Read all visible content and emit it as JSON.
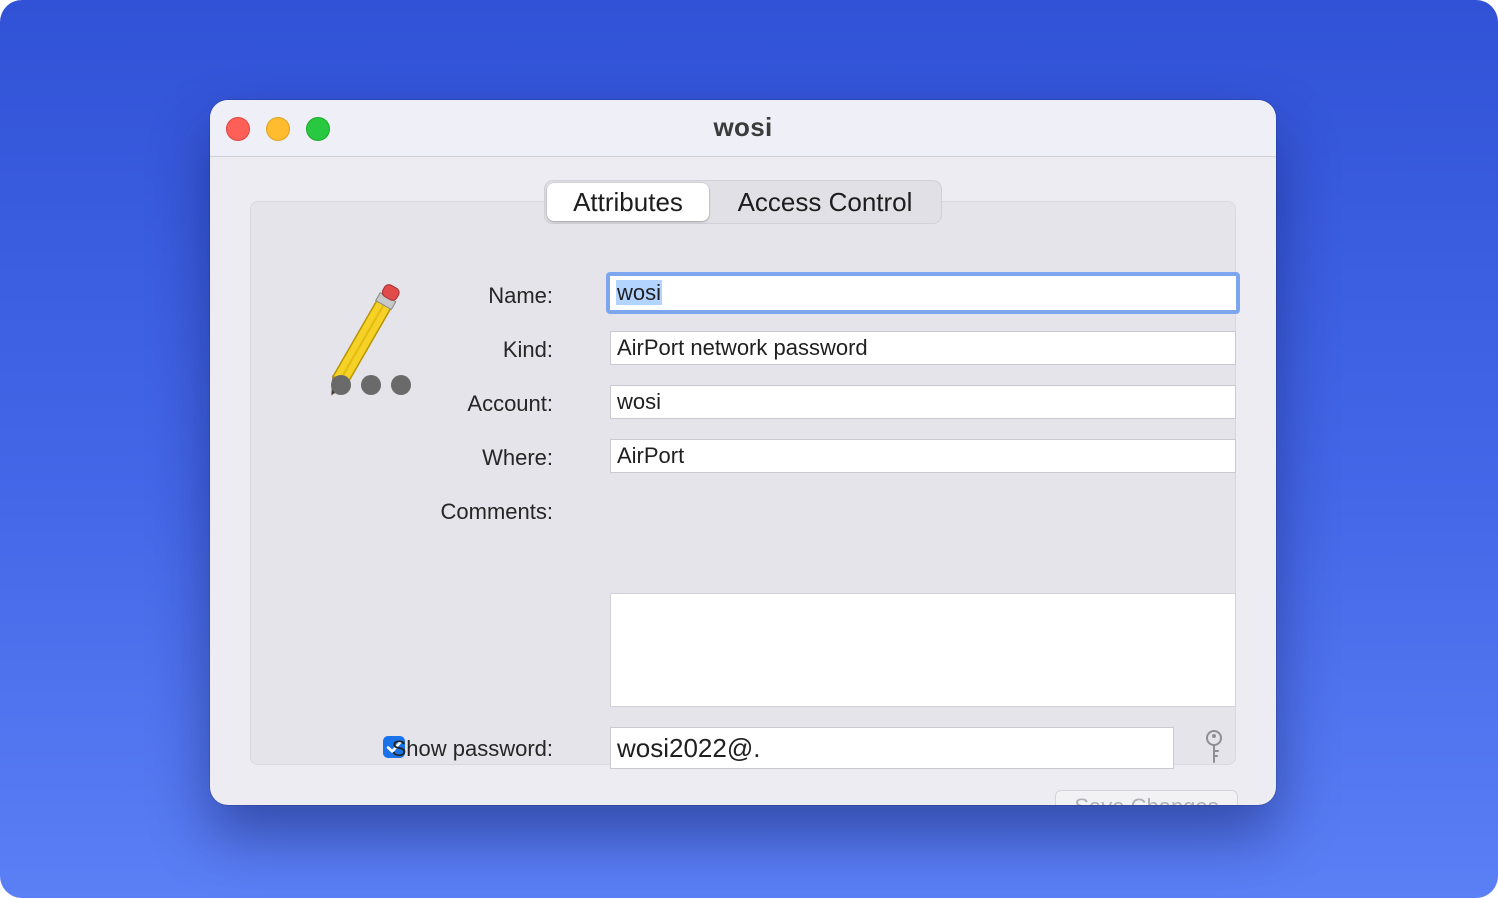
{
  "window": {
    "title": "wosi",
    "controls": [
      "close",
      "minimize",
      "zoom"
    ]
  },
  "tabs": [
    {
      "label": "Attributes",
      "active": true
    },
    {
      "label": "Access Control",
      "active": false
    }
  ],
  "form": {
    "name_label": "Name:",
    "name_value": "wosi",
    "kind_label": "Kind:",
    "kind_value": "AirPort network password",
    "account_label": "Account:",
    "account_value": "wosi",
    "where_label": "Where:",
    "where_value": "AirPort",
    "comments_label": "Comments:",
    "comments_value": "",
    "show_password_label": "Show password:",
    "show_password_checked": true,
    "password_value": "wosi2022@.",
    "save_label": "Save Changes"
  },
  "icons": {
    "item_icon": "pencil-password-icon",
    "key": "key-icon",
    "checkmark": "checkmark-icon"
  },
  "colors": {
    "accent": "#1a73e8",
    "focus_ring": "#7ea6ee",
    "selection": "#b3d4ff",
    "close": "#fe5f57",
    "minimize": "#febc2e",
    "zoom": "#28c840"
  }
}
